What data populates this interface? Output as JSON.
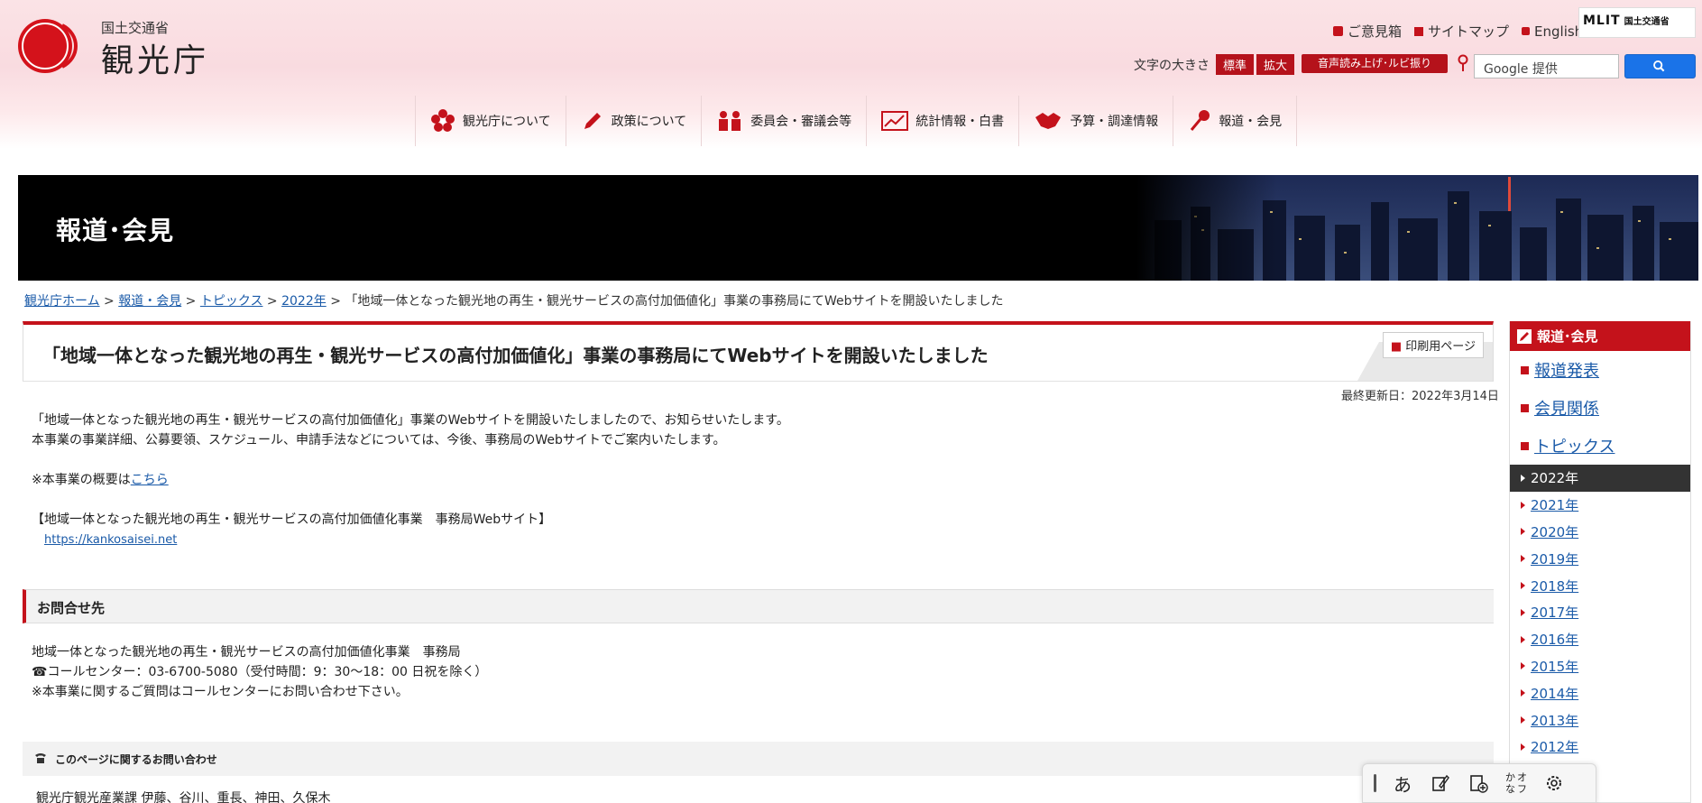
{
  "header": {
    "ministry": "国土交通省",
    "agency": "観光庁",
    "util_links": [
      "ご意見箱",
      "サイトマップ",
      "English"
    ],
    "mlit_logo": "MLIT",
    "mlit_ja": "国土交通省",
    "font_size_label": "文字の大きさ",
    "font_standard": "標準",
    "font_large": "拡大",
    "voice_button": "音声読み上げ･ルビ振り",
    "search_placeholder": "Google 提供"
  },
  "nav": [
    "観光庁について",
    "政策について",
    "委員会・審議会等",
    "統計情報・白書",
    "予算・調達情報",
    "報道・会見"
  ],
  "hero_title": "報道･会見",
  "breadcrumb": {
    "items": [
      "観光庁ホーム",
      "報道・会見",
      "トピックス",
      "2022年"
    ],
    "current": "「地域一体となった観光地の再生・観光サービスの高付加価値化」事業の事務局にてWebサイトを開設いたしました"
  },
  "article": {
    "title": "「地域一体となった観光地の再生・観光サービスの高付加価値化」事業の事務局にてWebサイトを開設いたしました",
    "print_label": "印刷用ページ",
    "updated": "最終更新日：2022年3月14日",
    "p1": "「地域一体となった観光地の再生・観光サービスの高付加価値化」事業のWebサイトを開設いたしましたので、お知らせいたします。",
    "p2": "本事業の事業詳細、公募要領、スケジュール、申請手法などについては、今後、事務局のWebサイトでご案内いたします。",
    "note_prefix": "※本事業の概要は",
    "note_link": "こちら",
    "site_heading": "【地域一体となった観光地の再生・観光サービスの高付加価値化事業　事務局Webサイト】",
    "site_url": "https://kankosaisei.net"
  },
  "contact": {
    "heading": "お問合せ先",
    "line1": "地域一体となった観光地の再生・観光サービスの高付加価値化事業　事務局",
    "line2": "☎コールセンター：03-6700-5080（受付時間：9：30～18：00 日祝を除く）",
    "line3": "※本事業に関するご質問はコールセンターにお問い合わせ下さい。"
  },
  "inquiry": {
    "heading": "このページに関するお問い合わせ",
    "text": "観光庁観光産業課 伊藤、谷川、重長、神田、久保木"
  },
  "sidebar": {
    "heading": "報道･会見",
    "links": [
      "報道発表",
      "会見関係",
      "トピックス"
    ],
    "years": [
      "2022年",
      "2021年",
      "2020年",
      "2019年",
      "2018年",
      "2017年",
      "2016年",
      "2015年",
      "2014年",
      "2013年",
      "2012年"
    ],
    "active_year": "2022年"
  },
  "ime": {
    "mode": "あ",
    "kana_top": "かな",
    "kana_bottom": "オフ"
  },
  "colors": {
    "accent": "#c4121b",
    "link": "#1a5aa8"
  }
}
